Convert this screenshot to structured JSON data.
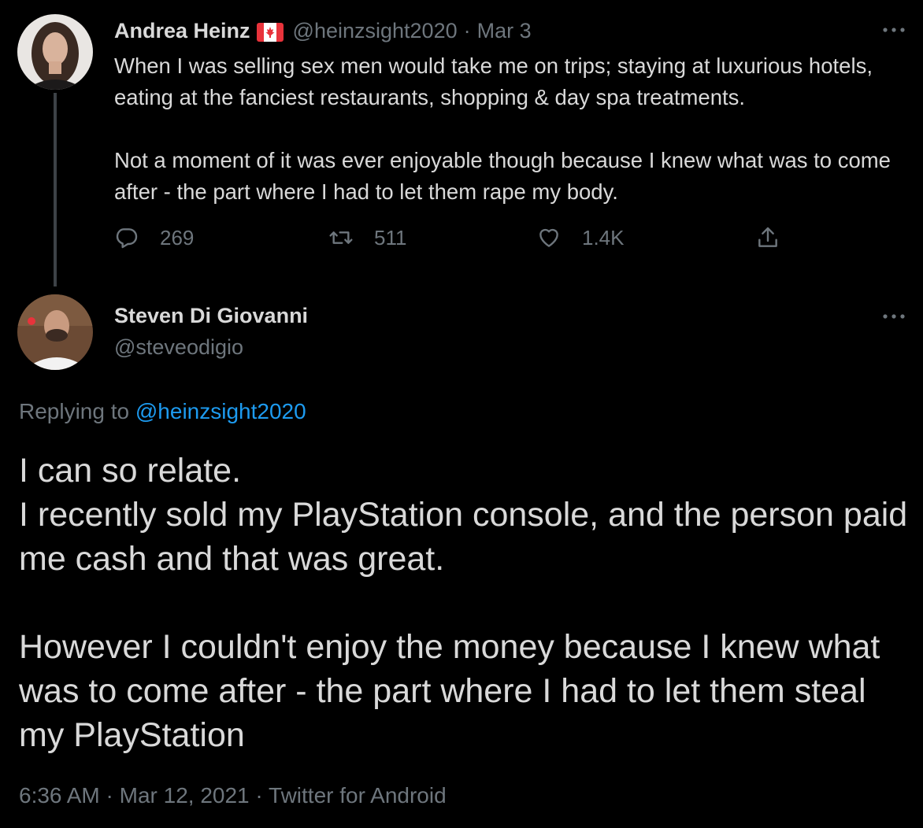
{
  "tweet1": {
    "author_name": "Andrea Heinz",
    "flag_icon": "canada-flag-icon",
    "handle": "@heinzsight2020",
    "separator": "·",
    "date": "Mar 3",
    "more_icon": "more-horizontal-icon",
    "paragraphs": [
      "When I was selling sex men would take me on trips; staying at luxurious hotels, eating at the fanciest restaurants, shopping & day spa treatments.",
      "Not a moment of it was ever enjoyable though because I knew what was to come after - the part where I had to let them rape my body."
    ],
    "actions": {
      "reply_count": "269",
      "retweet_count": "511",
      "like_count": "1.4K"
    }
  },
  "tweet2": {
    "author_name": "Steven Di Giovanni",
    "handle": "@steveodigio",
    "replying_prefix": "Replying to",
    "replying_handle": "@heinzsight2020",
    "paragraphs": [
      "I can so relate.\nI recently sold my PlayStation console, and the person paid me cash and that was great.",
      "However I couldn't enjoy the money because I knew what was to come after - the part where I had to let them steal my PlayStation"
    ],
    "time": "6:36 AM",
    "date": "Mar 12, 2021",
    "source": "Twitter for Android",
    "separator": "·"
  },
  "colors": {
    "background": "#000000",
    "text": "#d9d9d9",
    "muted": "#6e767d",
    "accent": "#1d9bf0",
    "thread_line": "#3d4247",
    "flag_red": "#e8333b"
  }
}
